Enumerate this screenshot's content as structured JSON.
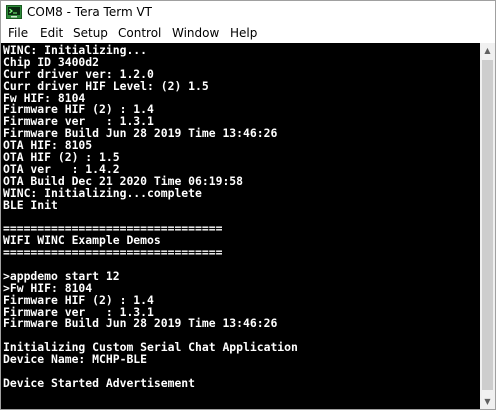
{
  "window": {
    "title": "COM8 - Tera Term VT"
  },
  "menu": {
    "items": [
      {
        "label": "File"
      },
      {
        "label": "Edit"
      },
      {
        "label": "Setup"
      },
      {
        "label": "Control"
      },
      {
        "label": "Window"
      },
      {
        "label": "Help"
      }
    ]
  },
  "icons": {
    "app": "teraterm-app-icon",
    "scroll_up": "chevron-up-icon",
    "scroll_down": "chevron-down-icon"
  },
  "colors": {
    "terminal_bg": "#000000",
    "terminal_fg": "#ffffff"
  },
  "terminal": {
    "lines": [
      "WINC: Initializing...",
      "Chip ID 3400d2",
      "Curr driver ver: 1.2.0",
      "Curr driver HIF Level: (2) 1.5",
      "Fw HIF: 8104",
      "Firmware HIF (2) : 1.4",
      "Firmware ver   : 1.3.1",
      "Firmware Build Jun 28 2019 Time 13:46:26",
      "OTA HIF: 8105",
      "OTA HIF (2) : 1.5",
      "OTA ver   : 1.4.2",
      "OTA Build Dec 21 2020 Time 06:19:58",
      "WINC: Initializing...complete",
      "BLE Init",
      "",
      "================================",
      "WIFI WINC Example Demos",
      "================================",
      "",
      ">appdemo start 12",
      ">Fw HIF: 8104",
      "Firmware HIF (2) : 1.4",
      "Firmware ver   : 1.3.1",
      "Firmware Build Jun 28 2019 Time 13:46:26",
      "",
      "Initializing Custom Serial Chat Application",
      "Device Name: MCHP-BLE",
      "",
      "Device Started Advertisement"
    ]
  }
}
